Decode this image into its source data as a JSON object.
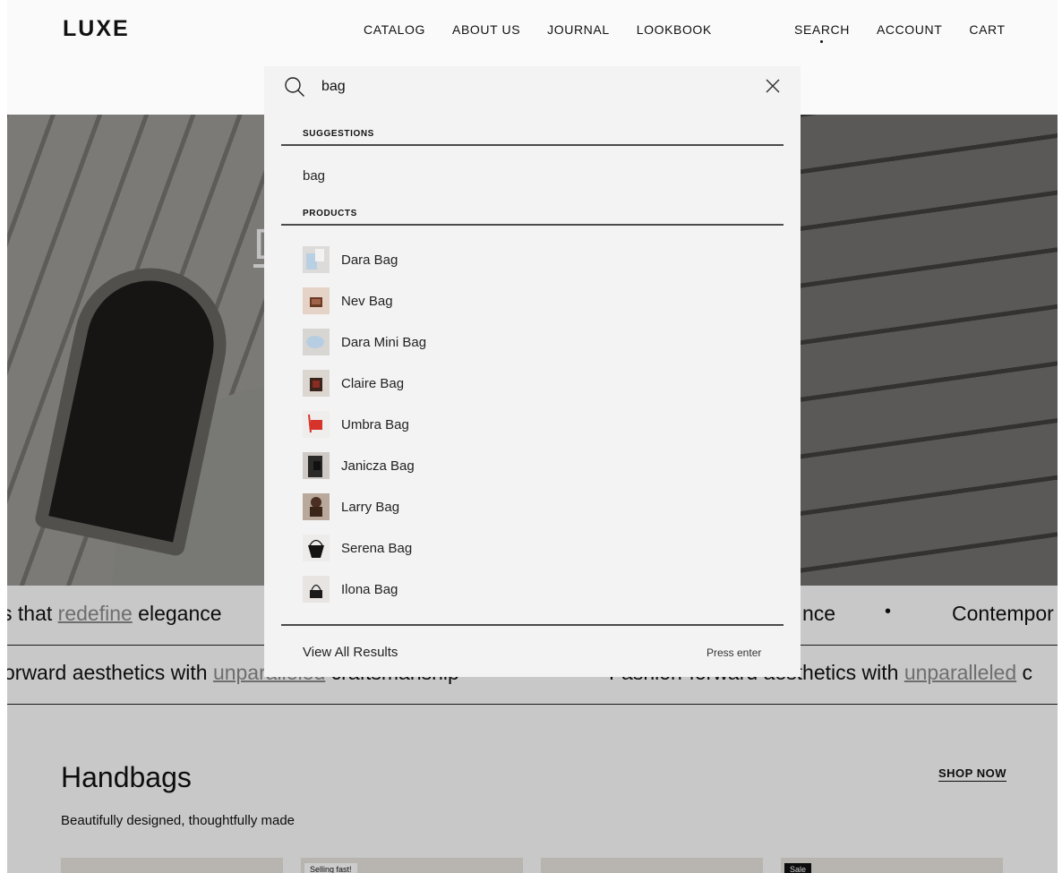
{
  "header": {
    "logo": "LUXE",
    "nav_main": [
      "CATALOG",
      "ABOUT US",
      "JOURNAL",
      "LOOKBOOK"
    ],
    "nav_right": [
      "SEARCH",
      "ACCOUNT",
      "CART"
    ]
  },
  "hero": {
    "title_fragment": "D                                                    s"
  },
  "marquee": {
    "row1": {
      "left_pre": "s that ",
      "left_hl": "redefine",
      "left_post": " elegance",
      "right_a": "nce",
      "bullet": "•",
      "right_b": "Contempor"
    },
    "row2": {
      "left_pre": "orward aesthetics with ",
      "left_hl": "unparalleled",
      "left_post": " craftsmanship",
      "right_pre": "Fashion-forward aesthetics with ",
      "right_hl": "unparalleled",
      "right_post": " c"
    }
  },
  "handbags": {
    "title": "Handbags",
    "subtitle": "Beautifully designed, thoughtfully made",
    "shop_now": "SHOP NOW",
    "badges": [
      "Selling fast!",
      "Sale"
    ]
  },
  "search": {
    "query": "bag",
    "suggestions_label": "SUGGESTIONS",
    "suggestion": "bag",
    "products_label": "PRODUCTS",
    "products": [
      {
        "name": "Dara Bag",
        "thumb": "light-blue"
      },
      {
        "name": "Nev Bag",
        "thumb": "brown"
      },
      {
        "name": "Dara Mini Bag",
        "thumb": "light-blue"
      },
      {
        "name": "Claire Bag",
        "thumb": "dark-plaid"
      },
      {
        "name": "Umbra Bag",
        "thumb": "red"
      },
      {
        "name": "Janicza Bag",
        "thumb": "black"
      },
      {
        "name": "Larry Bag",
        "thumb": "brown-dark"
      },
      {
        "name": "Serena Bag",
        "thumb": "black-bucket"
      },
      {
        "name": "Ilona Bag",
        "thumb": "black-small"
      }
    ],
    "view_all": "View All Results",
    "press_enter": "Press enter"
  },
  "colors": {
    "panel_bg": "#f3f3f3",
    "text": "#111111",
    "highlight": "#8a8a8a"
  }
}
